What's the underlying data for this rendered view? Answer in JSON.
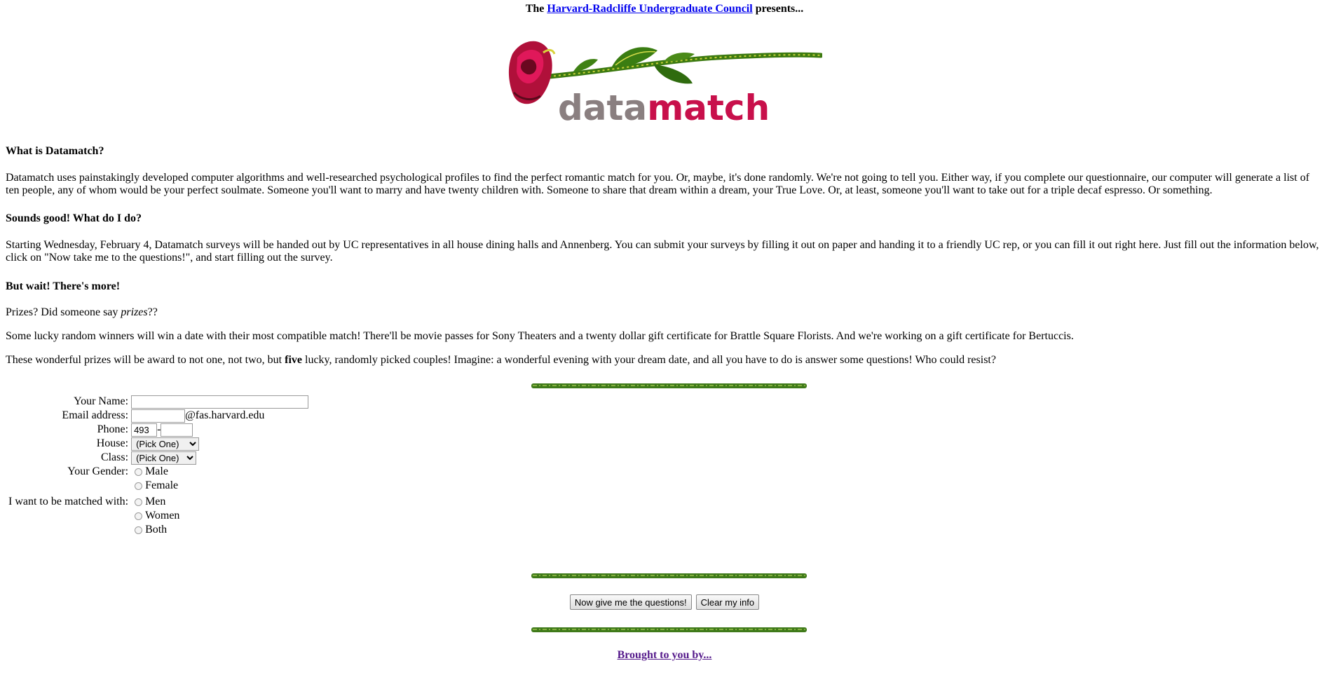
{
  "header": {
    "prefix": "The",
    "council_link": "Harvard-Radcliffe Undergraduate Council",
    "suffix": "presents..."
  },
  "logo": {
    "word_plain": "data",
    "word_accent": "match",
    "colors": {
      "plain": "#8a7f80",
      "accent": "#c8104b",
      "rose": "#b0103a",
      "stem": "#3c7a10"
    }
  },
  "sections": [
    {
      "heading": "What is Datamatch?",
      "paragraph": "Datamatch uses painstakingly developed computer algorithms and well-researched psychological profiles to find the perfect romantic match for you. Or, maybe, it's done randomly. We're not going to tell you. Either way, if you complete our questionnaire, our computer will generate a list of ten people, any of whom would be your perfect soulmate. Someone you'll want to marry and have twenty children with. Someone to share that dream within a dream, your True Love. Or, at least, someone you'll want to take out for a triple decaf espresso. Or something."
    },
    {
      "heading": "Sounds good! What do I do?",
      "paragraph": "Starting Wednesday, February 4, Datamatch surveys will be handed out by UC representatives in all house dining halls and Annenberg. You can submit your surveys by filling it out on paper and handing it to a friendly UC rep, or you can fill it out right here. Just fill out the information below, click on \"Now take me to the questions!\", and start filling out the survey."
    },
    {
      "heading": "But wait! There's more!"
    }
  ],
  "prizes": {
    "line1_a": "Prizes? Did someone say ",
    "line1_em": "prizes",
    "line1_b": "??",
    "line2": "Some lucky random winners will win a date with their most compatible match! There'll be movie passes for Sony Theaters and a twenty dollar gift certificate for Brattle Square Florists. And we're working on a gift certificate for Bertuccis.",
    "line3_a": "These wonderful prizes will be award to not one, not two, but ",
    "line3_b": "five",
    "line3_c": " lucky, randomly picked couples! Imagine: a wonderful evening with your dream date, and all you have to do is answer some questions! Who could resist?"
  },
  "form": {
    "name_label": "Your Name:",
    "name_value": "",
    "email_label": "Email address:",
    "email_value": "",
    "email_domain": "@fas.harvard.edu",
    "phone_label": "Phone:",
    "phone_prefix": "493",
    "phone_sep": "-",
    "phone_value": "",
    "house_label": "House:",
    "house_selected": "(Pick One)",
    "class_label": "Class:",
    "class_selected": "(Pick One)",
    "gender_label": "Your Gender:",
    "gender_options": [
      "Male",
      "Female"
    ],
    "match_label": "I want to be matched with:",
    "match_options": [
      "Men",
      "Women",
      "Both"
    ]
  },
  "buttons": {
    "submit": "Now give me the questions!",
    "clear": "Clear my info"
  },
  "footer": {
    "link": "Brought to you by..."
  }
}
